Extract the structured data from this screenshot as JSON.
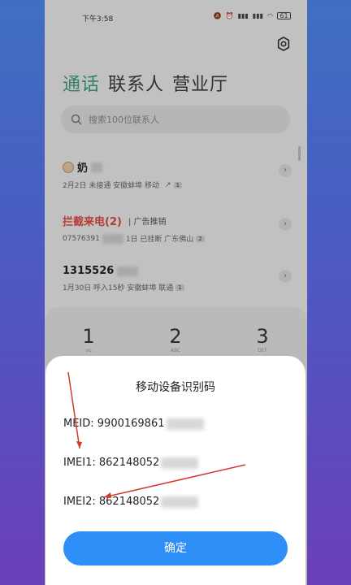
{
  "status_bar": {
    "time": "下午3:58",
    "battery": "61"
  },
  "tabs": [
    {
      "label": "通话",
      "active": true
    },
    {
      "label": "联系人",
      "active": false
    },
    {
      "label": "营业厅",
      "active": false
    }
  ],
  "search": {
    "placeholder": "搜索100位联系人"
  },
  "calls": [
    {
      "name": "奶",
      "meta": "2月2日 未接通 安徽蚌埠 移动",
      "count": "1"
    },
    {
      "name": "拦截来电(2)",
      "tag": "广告推销",
      "meta_prefix": "07576391",
      "meta": "1日 已挂断 广东佛山",
      "count": "2"
    },
    {
      "name": "1315526",
      "meta": "1月30日 呼入15秒 安徽蚌埠 联通",
      "count": "1"
    }
  ],
  "dialpad": [
    {
      "digit": "1",
      "letters": "oo"
    },
    {
      "digit": "2",
      "letters": "ABC"
    },
    {
      "digit": "3",
      "letters": "DEF"
    }
  ],
  "dialog": {
    "title": "移动设备识别码",
    "meid": "MEID: 9900169861",
    "imei1": "IMEI1: 862148052",
    "imei2": "IMEI2: 862148052",
    "confirm": "确定"
  },
  "colors": {
    "accent": "#3f9d7a",
    "button": "#2e8ff6",
    "annotation": "#d43a2c",
    "blocked": "#e04a3f"
  }
}
